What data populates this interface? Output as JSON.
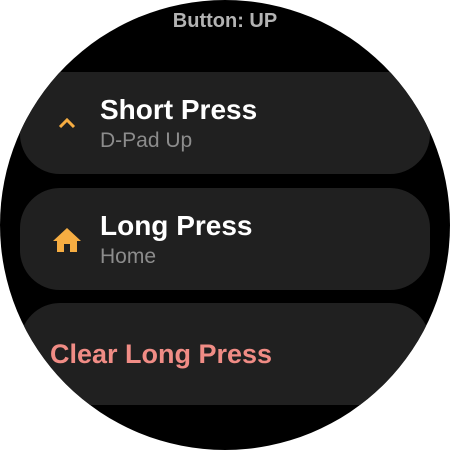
{
  "header": {
    "title": "Button: UP"
  },
  "short_press": {
    "label": "Short Press",
    "value": "D-Pad Up",
    "icon": "chevron-up-icon"
  },
  "long_press": {
    "label": "Long Press",
    "value": "Home",
    "icon": "home-icon"
  },
  "clear_long_press": {
    "label": "Clear Long Press"
  },
  "colors": {
    "background": "#000000",
    "chip": "#202020",
    "accent_icon": "#f6ad42",
    "primary_text": "#ffffff",
    "secondary_text": "#8c8c8c",
    "header_text": "#b3b3b3",
    "destructive_text": "#f08c85"
  }
}
